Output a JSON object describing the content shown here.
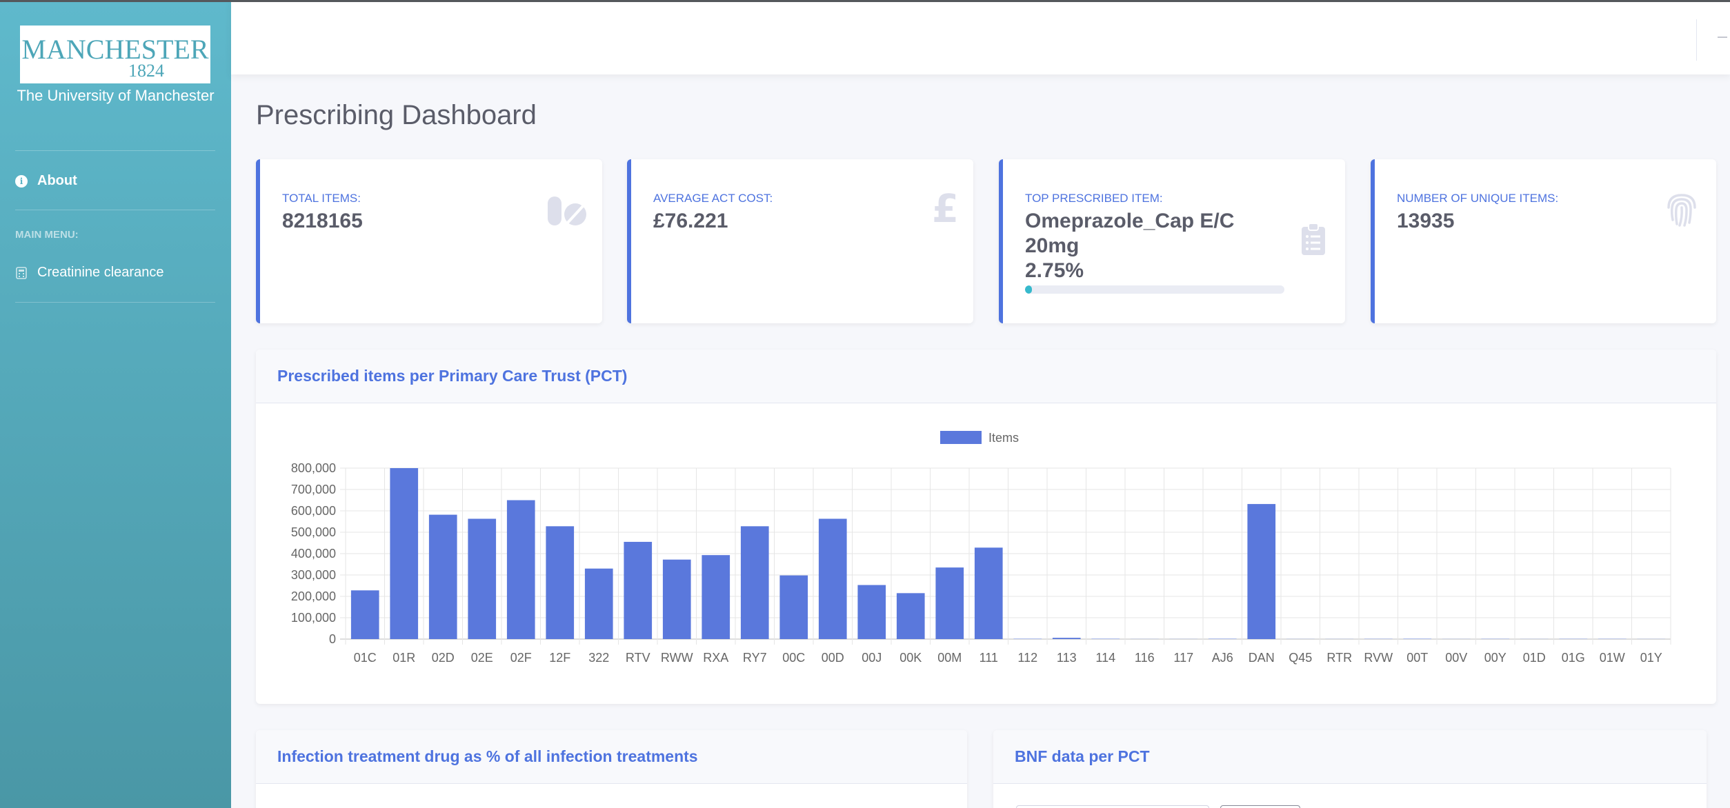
{
  "sidebar": {
    "logo_name": "MANCHESTER",
    "logo_year": "1824",
    "logo_sub": "The University of Manchester",
    "about_label": "About",
    "menu_heading": "MAIN MENU:",
    "creatinine_label": "Creatinine clearance"
  },
  "page": {
    "title": "Prescribing Dashboard"
  },
  "cards": [
    {
      "label": "TOTAL ITEMS:",
      "value": "8218165",
      "icon": "pills-icon"
    },
    {
      "label": "AVERAGE ACT COST:",
      "value": "£76.221",
      "icon": "pound-icon"
    },
    {
      "label": "TOP PRESCRIBED ITEM:",
      "value": "Omeprazole_Cap E/C 20mg",
      "percent": "2.75%",
      "progress": 2.75,
      "icon": "clipboard-list-icon"
    },
    {
      "label": "NUMBER OF UNIQUE ITEMS:",
      "value": "13935",
      "icon": "fingerprint-icon"
    }
  ],
  "panels": {
    "pct_title": "Prescribed items per Primary Care Trust (PCT)",
    "infection_title": "Infection treatment drug as % of all infection treatments",
    "bnf_title": "BNF data per PCT"
  },
  "colors": {
    "primary": "#4e73df",
    "bar": "#5a78dc",
    "info": "#36b9cc"
  },
  "chart_data": {
    "type": "bar",
    "categories": [
      "01C",
      "01R",
      "02D",
      "02E",
      "02F",
      "12F",
      "322",
      "RTV",
      "RWW",
      "RXA",
      "RY7",
      "00C",
      "00D",
      "00J",
      "00K",
      "00M",
      "111",
      "112",
      "113",
      "114",
      "116",
      "117",
      "AJ6",
      "DAN",
      "Q45",
      "RTR",
      "RVW",
      "00T",
      "00V",
      "00Y",
      "01D",
      "01G",
      "01W",
      "01Y"
    ],
    "series": [
      {
        "name": "Items",
        "values": [
          228000,
          800000,
          582000,
          563000,
          650000,
          528000,
          330000,
          455000,
          372000,
          393000,
          528000,
          298000,
          563000,
          253000,
          215000,
          335000,
          428000,
          1500,
          6000,
          1500,
          500,
          500,
          1500,
          632000,
          500,
          500,
          1000,
          1500,
          500,
          1000,
          500,
          1000,
          1000,
          500
        ]
      }
    ],
    "y_ticks": [
      "0",
      "100,000",
      "200,000",
      "300,000",
      "400,000",
      "500,000",
      "600,000",
      "700,000",
      "800,000"
    ],
    "ylim": [
      0,
      800000
    ],
    "grid": true,
    "legend": "top-center"
  }
}
